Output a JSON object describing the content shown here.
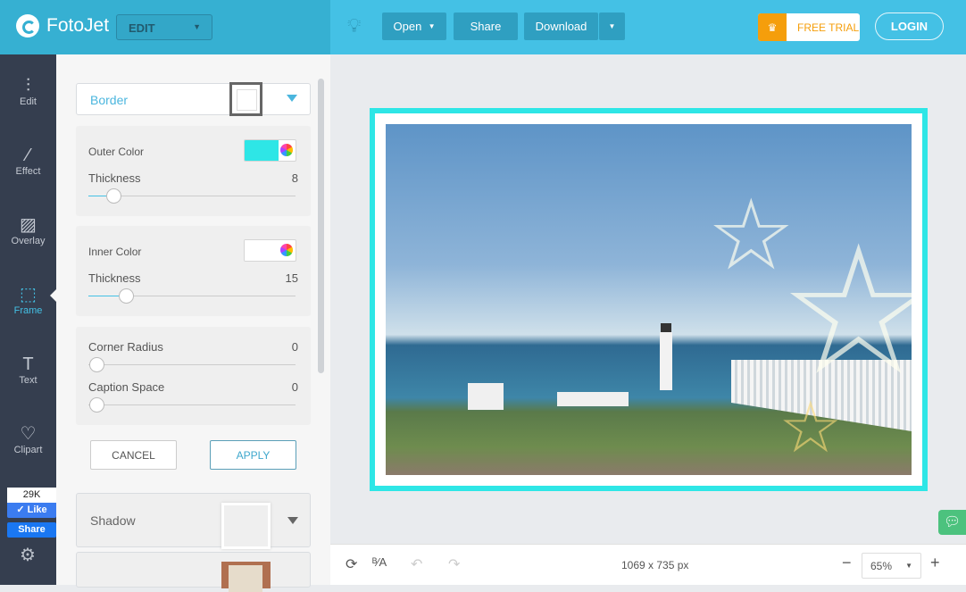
{
  "header": {
    "brand": "FotoJet",
    "mode_select": "EDIT",
    "open": "Open",
    "share": "Share",
    "download": "Download",
    "free_trial": "FREE TRIAL",
    "login": "LOGIN"
  },
  "sidebar": {
    "items": [
      {
        "label": "Edit"
      },
      {
        "label": "Effect"
      },
      {
        "label": "Overlay"
      },
      {
        "label": "Frame"
      },
      {
        "label": "Text"
      },
      {
        "label": "Clipart"
      }
    ],
    "active": "Frame",
    "fb_count": "29K",
    "fb_like": "Like",
    "fb_share": "Share"
  },
  "panel": {
    "frame_type": "Border",
    "outer_color_label": "Outer Color",
    "outer_color": "#2ee6e6",
    "thickness_label": "Thickness",
    "outer_thickness": "8",
    "outer_thickness_fraction": 0.12,
    "inner_color_label": "Inner Color",
    "inner_color": "#ffffff",
    "inner_thickness": "15",
    "inner_thickness_fraction": 0.18,
    "corner_radius_label": "Corner Radius",
    "corner_radius": "0",
    "caption_space_label": "Caption Space",
    "caption_space": "0",
    "cancel": "CANCEL",
    "apply": "APPLY",
    "shadow_label": "Shadow"
  },
  "footer": {
    "dimensions": "1069 x 735 px",
    "zoom": "65%"
  }
}
